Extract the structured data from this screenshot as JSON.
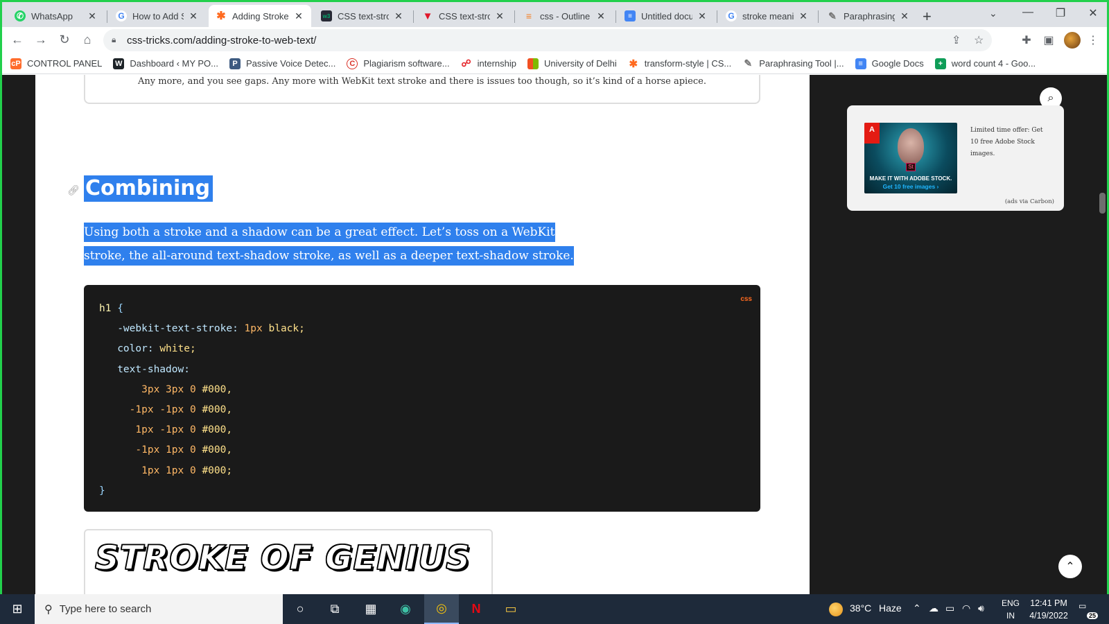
{
  "browser": {
    "tabs": [
      {
        "title": "WhatsApp",
        "icon": "whatsapp-icon",
        "color": "#25d366",
        "active": false
      },
      {
        "title": "How to Add S",
        "icon": "google-icon",
        "color": "#4285f4",
        "active": false
      },
      {
        "title": "Adding Stroke",
        "icon": "css-tricks-icon",
        "color": "#ff6a1f",
        "active": true
      },
      {
        "title": "CSS text-strok",
        "icon": "w3schools-icon",
        "color": "#282a35",
        "active": false
      },
      {
        "title": "CSS text-strok",
        "icon": "v-icon",
        "color": "#e0172a",
        "active": false
      },
      {
        "title": "css - Outline e",
        "icon": "stackoverflow-icon",
        "color": "#f48024",
        "active": false
      },
      {
        "title": "Untitled docu",
        "icon": "google-docs-icon",
        "color": "#4285f4",
        "active": false
      },
      {
        "title": "stroke meanin",
        "icon": "google-icon",
        "color": "#4285f4",
        "active": false
      },
      {
        "title": "Paraphrasing",
        "icon": "quill-icon",
        "color": "#777777",
        "active": false
      }
    ],
    "url": "css-tricks.com/adding-stroke-to-web-text/",
    "bookmarks": [
      {
        "label": "CONTROL PANEL",
        "icon": "cpanel-icon",
        "color": "#ff6c2c"
      },
      {
        "label": "Dashboard ‹ MY PO...",
        "icon": "wordpress-icon",
        "color": "#1d2327"
      },
      {
        "label": "Passive Voice Detec...",
        "icon": "document-icon",
        "color": "#3d5a80"
      },
      {
        "label": "Plagiarism software...",
        "icon": "copyright-icon",
        "color": "#d93025"
      },
      {
        "label": "internship",
        "icon": "internshala-icon",
        "color": "#e5252a"
      },
      {
        "label": "University of Delhi",
        "icon": "microsoft-icon",
        "color": "#f25022"
      },
      {
        "label": "transform-style | CS...",
        "icon": "css-tricks-icon",
        "color": "#ff6a1f"
      },
      {
        "label": "Paraphrasing Tool |...",
        "icon": "quill-icon",
        "color": "#777777"
      },
      {
        "label": "Google Docs",
        "icon": "google-docs-icon",
        "color": "#4285f4"
      },
      {
        "label": "word count 4 - Goo...",
        "icon": "google-sheets-icon",
        "color": "#0f9d58"
      }
    ]
  },
  "article": {
    "callout_text": "Any more, and you see gaps. Any more with WebKit text stroke and there is issues too though, so it’s kind of a horse apiece.",
    "heading": "Combining",
    "paragraph_line1": "Using both a stroke and a shadow can be a great effect. Let’s toss on a WebKit",
    "paragraph_line2": "stroke, the all-around text-shadow stroke, as well as a deeper text-shadow stroke.",
    "code_lang": "css",
    "code": {
      "selector": "h1",
      "open": "{",
      "close": "}",
      "l1_prop": "-webkit-text-stroke:",
      "l1_num": "1px",
      "l1_val": "black;",
      "l2_prop": "color:",
      "l2_val": "white;",
      "l3_prop": "text-shadow:",
      "s1_a": "3px",
      "s1_b": "3px",
      "s1_c": "0",
      "s1_hex": "#000,",
      "s2_a": "-1px",
      "s2_b": "-1px",
      "s2_c": "0",
      "s2_hex": "#000,",
      "s3_a": "1px",
      "s3_b": "-1px",
      "s3_c": "0",
      "s3_hex": "#000,",
      "s4_a": "-1px",
      "s4_b": "1px",
      "s4_c": "0",
      "s4_hex": "#000,",
      "s5_a": "1px",
      "s5_b": "1px",
      "s5_c": "0",
      "s5_hex": "#000;"
    },
    "demo_text": "STROKE OF GENIUS"
  },
  "sidebar": {
    "ad_logo": "Adobe",
    "ad_badge": "St",
    "ad_line1": "MAKE IT WITH ADOBE STOCK.",
    "ad_line2": "Get 10 free images ›",
    "ad_text": "Limited time offer: Get 10 free Adobe Stock images.",
    "ad_via": "(ads via Carbon)"
  },
  "taskbar": {
    "search_placeholder": "Type here to search",
    "temperature": "38°C",
    "weather": "Haze",
    "lang1": "ENG",
    "lang2": "IN",
    "time": "12:41 PM",
    "date": "4/19/2022",
    "notifications": "25"
  },
  "colors": {
    "accent_selection": "#2f80ed",
    "frame_border": "#22d04c",
    "code_bg": "#1a1a1a",
    "css_tricks_orange": "#ff6a1f"
  }
}
